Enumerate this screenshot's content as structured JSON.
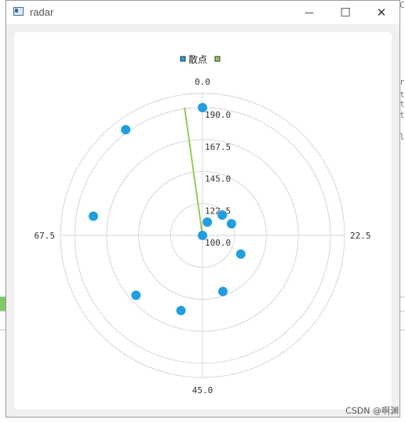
{
  "window": {
    "title": "radar",
    "minimize_glyph": "—",
    "maximize_glyph": "☐",
    "close_glyph": "✕"
  },
  "background_text": {
    "line_1": "C",
    "line_2": "r",
    "line_3": "t",
    "line_4": "t",
    "line_5": "t",
    "line_6": "l"
  },
  "watermark": "CSDN @啊渊",
  "colors": {
    "scatter": "#209fdf",
    "line": "#99ca53",
    "grid": "#d7d7d7",
    "legend_line": "#6fb53b"
  },
  "chart_data": {
    "type": "scatter",
    "coordinate_system": "polar",
    "legend": [
      {
        "name": "散点",
        "color": "#209fdf"
      },
      {
        "name": "",
        "color": "#99ca53"
      }
    ],
    "angular_axis": {
      "range": [
        0,
        90
      ],
      "tick_labels": [
        "0.0",
        "22.5",
        "45.0",
        "67.5"
      ],
      "ticks": [
        0,
        22.5,
        45,
        67.5
      ]
    },
    "radial_axis": {
      "range": [
        100,
        200
      ],
      "tick_labels": [
        "100.0",
        "122.5",
        "145.0",
        "167.5",
        "190.0"
      ],
      "ticks": [
        100,
        122.5,
        145,
        167.5,
        190
      ]
    },
    "series": [
      {
        "name": "散点",
        "kind": "scatter",
        "points": [
          {
            "angle": 0,
            "radius": 190
          },
          {
            "angle": 81,
            "radius": 192
          },
          {
            "angle": 70,
            "radius": 178
          },
          {
            "angle": 57,
            "radius": 163
          },
          {
            "angle": 49,
            "radius": 155
          },
          {
            "angle": 40,
            "radius": 142
          },
          {
            "angle": 29,
            "radius": 130
          },
          {
            "angle": 17,
            "radius": 122
          },
          {
            "angle": 11,
            "radius": 120
          },
          {
            "angle": 5,
            "radius": 110
          },
          {
            "angle": 0,
            "radius": 100
          }
        ]
      },
      {
        "name": "",
        "kind": "line",
        "points": [
          {
            "angle": 0,
            "radius": 100
          },
          {
            "angle": 88,
            "radius": 191
          }
        ]
      }
    ]
  }
}
